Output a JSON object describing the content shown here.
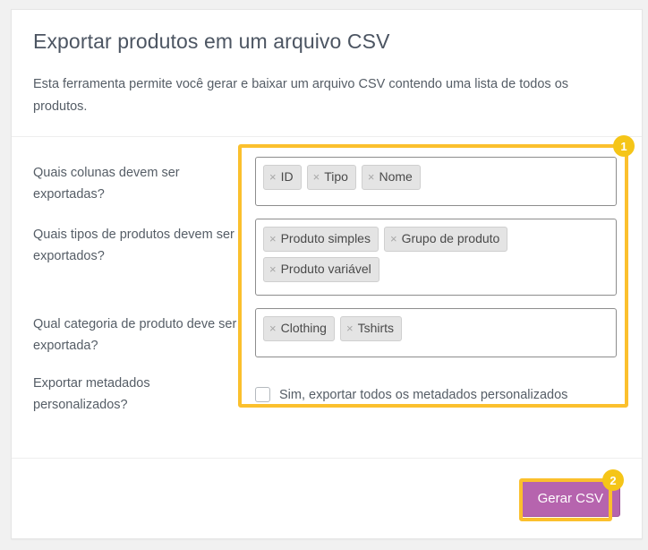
{
  "page": {
    "title": "Exportar produtos em um arquivo CSV",
    "description": "Esta ferramenta permite você gerar e baixar um arquivo CSV contendo uma lista de todos os produtos."
  },
  "form": {
    "rows": [
      {
        "label": "Quais colunas devem ser exportadas?",
        "chips": [
          "ID",
          "Tipo",
          "Nome"
        ]
      },
      {
        "label": "Quais tipos de produtos devem ser exportados?",
        "chips": [
          "Produto simples",
          "Grupo de produto",
          "Produto variável"
        ]
      },
      {
        "label": "Qual categoria de produto deve ser exportada?",
        "chips": [
          "Clothing",
          "Tshirts"
        ]
      }
    ],
    "meta_row": {
      "label": "Exportar metadados personalizados?",
      "checkbox_label": "Sim, exportar todos os metadados personalizados",
      "checked": false
    },
    "chip_remove_glyph": "×"
  },
  "footer": {
    "submit_label": "Gerar CSV"
  },
  "annotations": {
    "badge_1": "1",
    "badge_2": "2",
    "highlight_color": "#fbc02d",
    "badge_color": "#f5c518"
  },
  "colors": {
    "page_background": "#f1f1f1",
    "card_background": "#ffffff",
    "text": "#555d66",
    "title": "#4c5562",
    "primary_button": "#b664ae",
    "chip_background": "#e4e4e4"
  }
}
